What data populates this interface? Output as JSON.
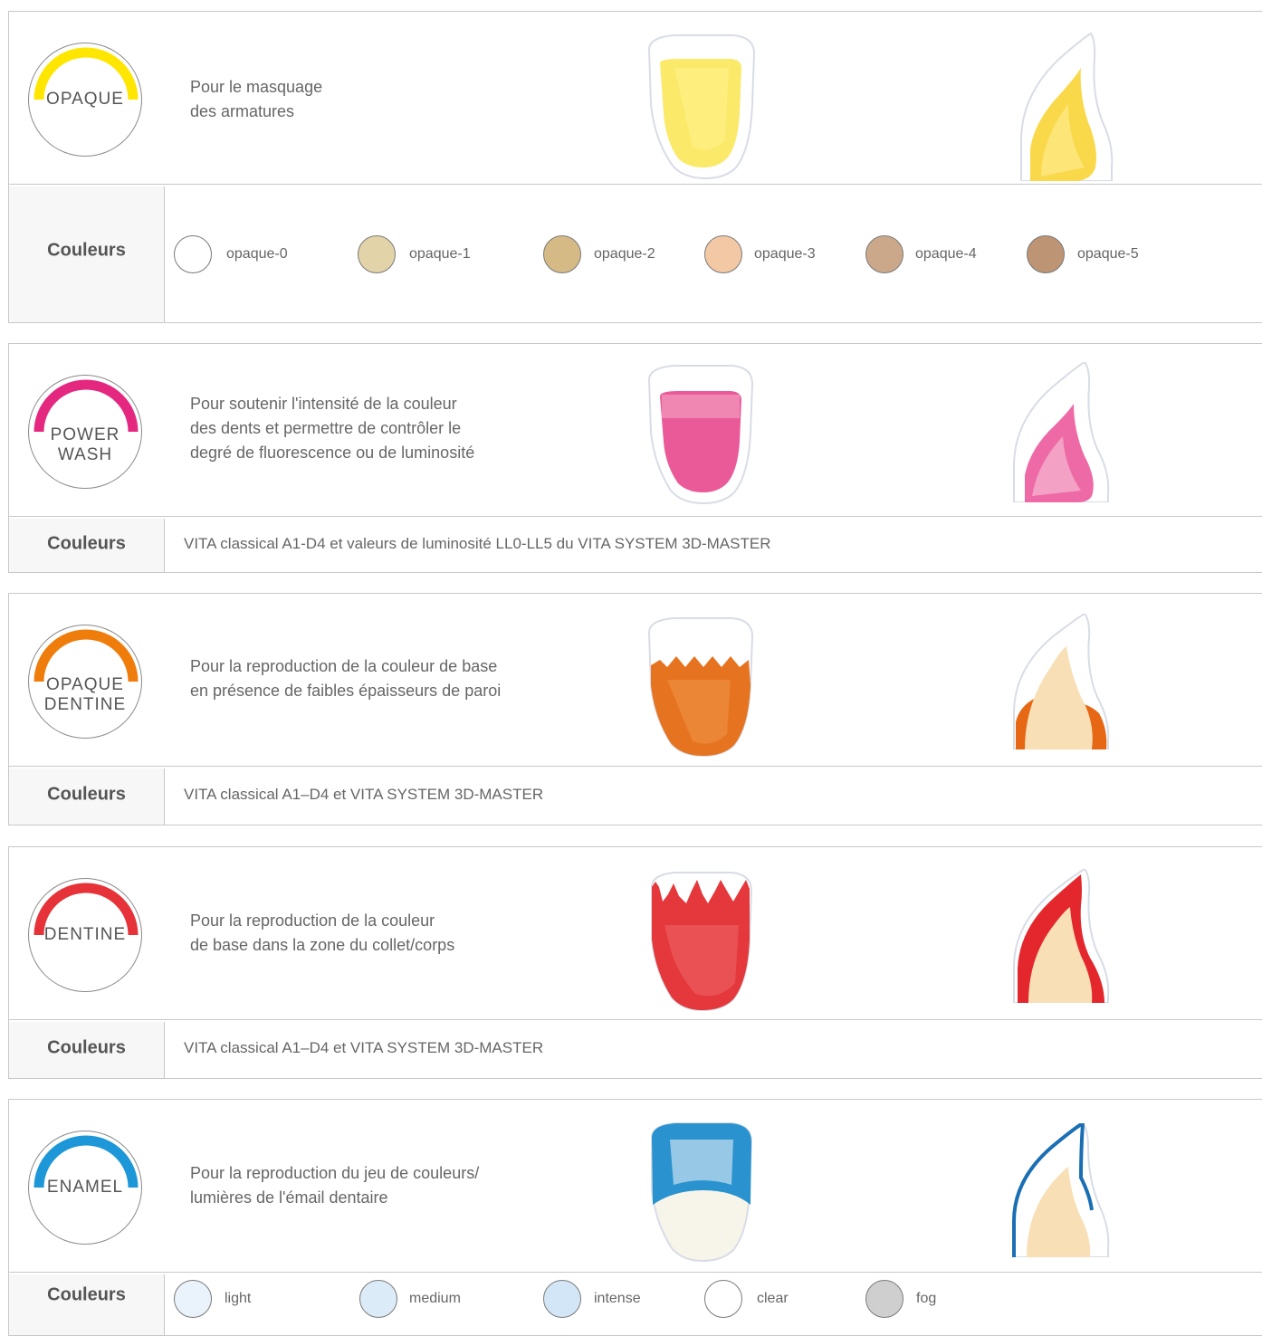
{
  "label_colors": "Couleurs",
  "sections": [
    {
      "id": "opaque",
      "badge": "OPAQUE",
      "accent": "#ffe600",
      "description": "Pour le masquage\ndes armatures",
      "shades": [
        {
          "name": "opaque-0",
          "color": "#ffffff"
        },
        {
          "name": "opaque-1",
          "color": "#e3d3a8"
        },
        {
          "name": "opaque-2",
          "color": "#d6ba86"
        },
        {
          "name": "opaque-3",
          "color": "#f3c9a5"
        },
        {
          "name": "opaque-4",
          "color": "#cba88a"
        },
        {
          "name": "opaque-5",
          "color": "#bd9474"
        }
      ]
    },
    {
      "id": "power-wash",
      "badge": "POWER\nWASH",
      "accent": "#e5287f",
      "description": "Pour soutenir l'intensité de la couleur\ndes dents et permettre de contrôler le\ndegré de fluorescence ou de luminosité",
      "shades_text": "VITA classical A1-D4 et valeurs de luminosité LL0-LL5 du VITA SYSTEM 3D-MASTER"
    },
    {
      "id": "opaque-dentine",
      "badge": "OPAQUE\nDENTINE",
      "accent": "#ef7d0b",
      "description": "Pour la reproduction de la couleur de base\nen présence de faibles épaisseurs de paroi",
      "shades_text": "VITA classical A1–D4 et VITA SYSTEM 3D-MASTER"
    },
    {
      "id": "dentine",
      "badge": "DENTINE",
      "accent": "#e63339",
      "description": "Pour la reproduction de la couleur\nde base dans la zone du collet/corps",
      "shades_text": "VITA classical A1–D4 et VITA SYSTEM 3D-MASTER"
    },
    {
      "id": "enamel",
      "badge": "ENAMEL",
      "accent": "#1d97d7",
      "description": "Pour la reproduction du jeu de couleurs/\nlumières de l'émail dentaire",
      "shades": [
        {
          "name": "light",
          "color": "#eaf2fb"
        },
        {
          "name": "medium",
          "color": "#dcebf8"
        },
        {
          "name": "intense",
          "color": "#d3e6f7"
        },
        {
          "name": "clear",
          "color": "#ffffff"
        },
        {
          "name": "fog",
          "color": "#cfcfcf"
        }
      ]
    }
  ]
}
